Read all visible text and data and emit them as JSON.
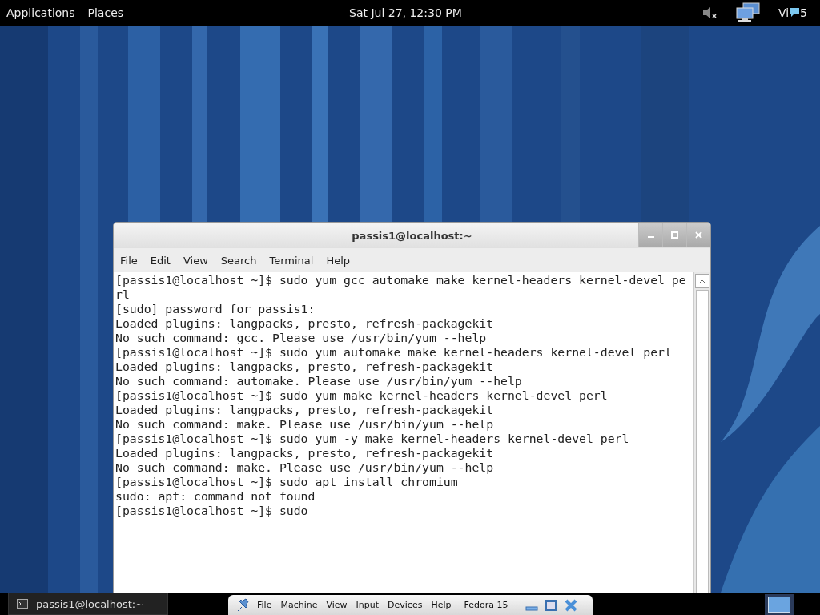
{
  "top_panel": {
    "menus": [
      "Applications",
      "Places"
    ],
    "clock": "Sat Jul 27, 12:30 PM",
    "user_label_start": "Vi",
    "user_label_end": "5"
  },
  "terminal_window": {
    "title": "passis1@localhost:~",
    "menu": [
      "File",
      "Edit",
      "View",
      "Search",
      "Terminal",
      "Help"
    ],
    "lines": [
      "[passis1@localhost ~]$ sudo yum gcc automake make kernel-headers kernel-devel pe",
      "rl",
      "[sudo] password for passis1:",
      "Loaded plugins: langpacks, presto, refresh-packagekit",
      "No such command: gcc. Please use /usr/bin/yum --help",
      "[passis1@localhost ~]$ sudo yum automake make kernel-headers kernel-devel perl",
      "Loaded plugins: langpacks, presto, refresh-packagekit",
      "No such command: automake. Please use /usr/bin/yum --help",
      "[passis1@localhost ~]$ sudo yum make kernel-headers kernel-devel perl",
      "Loaded plugins: langpacks, presto, refresh-packagekit",
      "No such command: make. Please use /usr/bin/yum --help",
      "[passis1@localhost ~]$ sudo yum -y make kernel-headers kernel-devel perl",
      "Loaded plugins: langpacks, presto, refresh-packagekit",
      "No such command: make. Please use /usr/bin/yum --help",
      "[passis1@localhost ~]$ sudo apt install chromium",
      "sudo: apt: command not found",
      "[passis1@localhost ~]$ sudo"
    ]
  },
  "bottom_panel": {
    "task": "passis1@localhost:~",
    "vm_menu": [
      "File",
      "Machine",
      "View",
      "Input",
      "Devices",
      "Help"
    ],
    "vm_name": "Fedora 15"
  }
}
